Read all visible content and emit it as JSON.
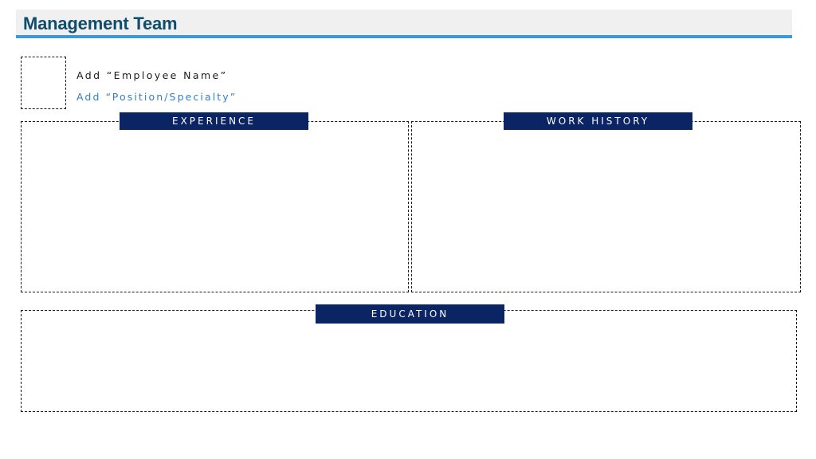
{
  "header": {
    "title": "Management Team",
    "band_color": "#f0f0f0",
    "rule_color": "#3a9ad9",
    "title_color": "#0e4d6e"
  },
  "employee": {
    "name_placeholder": "Add “Employee Name”",
    "position_placeholder": "Add “Position/Specialty”",
    "position_color": "#2f7fcf"
  },
  "sections": {
    "experience": {
      "label": "EXPERIENCE"
    },
    "work_history": {
      "label": "WORK HISTORY"
    },
    "education": {
      "label": "EDUCATION"
    },
    "label_bg_color": "#0b2464"
  }
}
